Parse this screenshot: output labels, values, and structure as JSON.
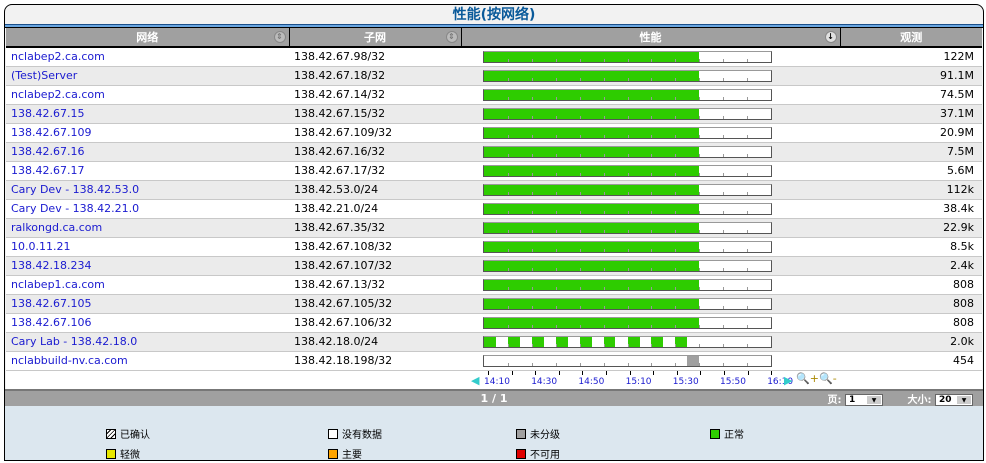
{
  "title": "性能(按网络)",
  "columns": [
    "网络",
    "子网",
    "性能",
    "观测"
  ],
  "colors": {
    "normal": "#2ecc00",
    "unclassified": "#a0a0a0",
    "none": "#ffffff",
    "minor": "#e8e800",
    "major": "#ffa500",
    "down": "#e00000"
  },
  "rows": [
    {
      "network": "nclabep2.ca.com",
      "subnet": "138.42.67.98/32",
      "observed": "122M",
      "perf": [
        [
          0,
          0.75,
          "normal"
        ]
      ]
    },
    {
      "network": "(Test)Server",
      "subnet": "138.42.67.18/32",
      "observed": "91.1M",
      "perf": [
        [
          0,
          0.75,
          "normal"
        ]
      ]
    },
    {
      "network": "nclabep2.ca.com",
      "subnet": "138.42.67.14/32",
      "observed": "74.5M",
      "perf": [
        [
          0,
          0.75,
          "normal"
        ]
      ]
    },
    {
      "network": "138.42.67.15",
      "subnet": "138.42.67.15/32",
      "observed": "37.1M",
      "perf": [
        [
          0,
          0.75,
          "normal"
        ]
      ]
    },
    {
      "network": "138.42.67.109",
      "subnet": "138.42.67.109/32",
      "observed": "20.9M",
      "perf": [
        [
          0,
          0.75,
          "normal"
        ]
      ]
    },
    {
      "network": "138.42.67.16",
      "subnet": "138.42.67.16/32",
      "observed": "7.5M",
      "perf": [
        [
          0,
          0.75,
          "normal"
        ]
      ]
    },
    {
      "network": "138.42.67.17",
      "subnet": "138.42.67.17/32",
      "observed": "5.6M",
      "perf": [
        [
          0,
          0.75,
          "normal"
        ]
      ]
    },
    {
      "network": "Cary Dev - 138.42.53.0",
      "subnet": "138.42.53.0/24",
      "observed": "112k",
      "perf": [
        [
          0,
          0.75,
          "normal"
        ]
      ]
    },
    {
      "network": "Cary Dev - 138.42.21.0",
      "subnet": "138.42.21.0/24",
      "observed": "38.4k",
      "perf": [
        [
          0,
          0.75,
          "normal"
        ]
      ]
    },
    {
      "network": "ralkongd.ca.com",
      "subnet": "138.42.67.35/32",
      "observed": "22.9k",
      "perf": [
        [
          0,
          0.75,
          "normal"
        ]
      ]
    },
    {
      "network": "10.0.11.21",
      "subnet": "138.42.67.108/32",
      "observed": "8.5k",
      "perf": [
        [
          0,
          0.75,
          "normal"
        ]
      ]
    },
    {
      "network": "138.42.18.234",
      "subnet": "138.42.67.107/32",
      "observed": "2.4k",
      "perf": [
        [
          0,
          0.75,
          "normal"
        ]
      ]
    },
    {
      "network": "nclabep1.ca.com",
      "subnet": "138.42.67.13/32",
      "observed": "808",
      "perf": [
        [
          0,
          0.75,
          "normal"
        ]
      ]
    },
    {
      "network": "138.42.67.105",
      "subnet": "138.42.67.105/32",
      "observed": "808",
      "perf": [
        [
          0,
          0.75,
          "normal"
        ]
      ]
    },
    {
      "network": "138.42.67.106",
      "subnet": "138.42.67.106/32",
      "observed": "808",
      "perf": [
        [
          0,
          0.75,
          "normal"
        ]
      ]
    },
    {
      "network": "Cary Lab - 138.42.18.0",
      "subnet": "138.42.18.0/24",
      "observed": "2.0k",
      "perf": [
        [
          0,
          0.042,
          "normal"
        ],
        [
          0.083,
          0.125,
          "normal"
        ],
        [
          0.167,
          0.208,
          "normal"
        ],
        [
          0.25,
          0.292,
          "normal"
        ],
        [
          0.333,
          0.375,
          "normal"
        ],
        [
          0.417,
          0.458,
          "normal"
        ],
        [
          0.5,
          0.542,
          "normal"
        ],
        [
          0.583,
          0.625,
          "normal"
        ],
        [
          0.667,
          0.708,
          "normal"
        ]
      ]
    },
    {
      "network": "nclabbuild-nv.ca.com",
      "subnet": "138.42.18.198/32",
      "observed": "454",
      "perf": [
        [
          0.708,
          0.75,
          "unclassified"
        ]
      ]
    }
  ],
  "time_axis": [
    "14:10",
    "14:30",
    "14:50",
    "15:10",
    "15:30",
    "15:50",
    "16:10"
  ],
  "pager": {
    "text": "1 / 1",
    "page_label": "页:",
    "page_value": "1",
    "size_label": "大小:",
    "size_value": "20"
  },
  "legend": [
    {
      "label": "已确认",
      "color": "hatch"
    },
    {
      "label": "没有数据",
      "color": "#ffffff"
    },
    {
      "label": "未分级",
      "color": "#a0a0a0"
    },
    {
      "label": "正常",
      "color": "#2ecc00"
    },
    {
      "label": "轻微",
      "color": "#e8e800"
    },
    {
      "label": "主要",
      "color": "#ffa500"
    },
    {
      "label": "不可用",
      "color": "#e00000"
    }
  ]
}
